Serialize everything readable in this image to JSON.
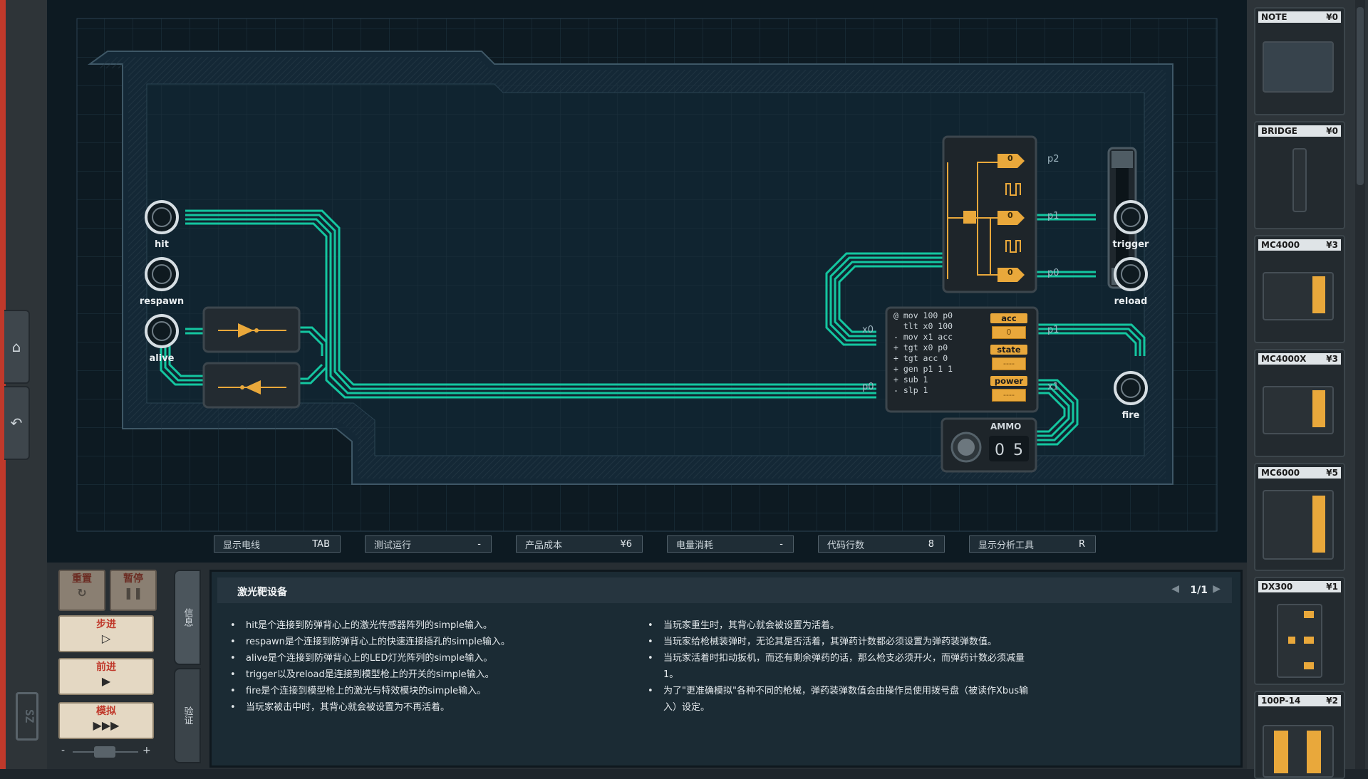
{
  "board": {
    "inputs": [
      {
        "label": "hit"
      },
      {
        "label": "respawn"
      },
      {
        "label": "alive"
      }
    ],
    "outputs": [
      {
        "label": "trigger"
      },
      {
        "label": "reload"
      },
      {
        "label": "fire"
      }
    ],
    "dx300_ports": {
      "p2": "p2",
      "p1": "p1",
      "p0": "p0",
      "bit0": "0",
      "bit1": "0",
      "bit2": "0"
    },
    "mc4000x": {
      "code": "@ mov 100 p0\n  tlt x0 100\n- mov x1 acc\n+ tgt x0 p0\n+ tgt acc 0\n+ gen p1 1 1\n+ sub 1\n- slp 1",
      "reg_acc": "acc",
      "reg_acc_val": "0",
      "reg_state": "state",
      "reg_state_val": "----",
      "reg_power": "power",
      "reg_power_val": "----",
      "port_x0": "x0",
      "port_p0": "p0",
      "port_p1": "p1",
      "port_x1": "x1"
    },
    "ammo": {
      "title": "AMMO",
      "digit1": "0",
      "digit2": "5"
    }
  },
  "statusbar": {
    "show_wires": {
      "label": "显示电线",
      "key": "TAB"
    },
    "test_run": {
      "label": "测试运行",
      "value": "-"
    },
    "product_cost": {
      "label": "产品成本",
      "value": "¥6"
    },
    "power_usage": {
      "label": "电量消耗",
      "value": "-"
    },
    "code_lines": {
      "label": "代码行数",
      "value": "8"
    },
    "show_analysis": {
      "label": "显示分析工具",
      "key": "R"
    }
  },
  "controls": {
    "reset": "重置",
    "pause": "暂停",
    "step": "步进",
    "step_icon": "▷",
    "advance": "前进",
    "advance_icon": "▶",
    "simulate": "模拟",
    "simulate_icon": "▶▶▶",
    "minus": "-",
    "plus": "+"
  },
  "side_tabs": {
    "info": "信息",
    "verify": "验证"
  },
  "info": {
    "title": "激光靶设备",
    "page": "1/1",
    "left_items": [
      "hit是个连接到防弹背心上的激光传感器阵列的simple输入。",
      "respawn是个连接到防弹背心上的快速连接插孔的simple输入。",
      "alive是个连接到防弹背心上的LED灯光阵列的simple输入。",
      "trigger以及reload是连接到模型枪上的开关的simple输入。",
      "fire是个连接到模型枪上的激光与特效模块的simple输入。",
      "当玩家被击中时，其背心就会被设置为不再活着。"
    ],
    "right_items": [
      "当玩家重生时，其背心就会被设置为活着。",
      "当玩家给枪械装弹时，无论其是否活着，其弹药计数都必须设置为弹药装弹数值。",
      "当玩家活着时扣动扳机，而还有剩余弹药的话，那么枪支必须开火，而弹药计数必须减量1。",
      "为了\"更准确模拟\"各种不同的枪械，弹药装弹数值会由操作员使用拨号盘（被读作Xbus输入）设定。"
    ]
  },
  "palette": [
    {
      "name": "NOTE",
      "price": "¥0"
    },
    {
      "name": "BRIDGE",
      "price": "¥0"
    },
    {
      "name": "MC4000",
      "price": "¥3"
    },
    {
      "name": "MC4000X",
      "price": "¥3"
    },
    {
      "name": "MC6000",
      "price": "¥5"
    },
    {
      "name": "DX300",
      "price": "¥1"
    },
    {
      "name": "100P-14",
      "price": "¥2"
    }
  ],
  "colors": {
    "wire_active": "#14c6a0",
    "chip_orange": "#e9a83b",
    "board_bg": "#0f1f29",
    "accent_red": "#c0392b"
  }
}
